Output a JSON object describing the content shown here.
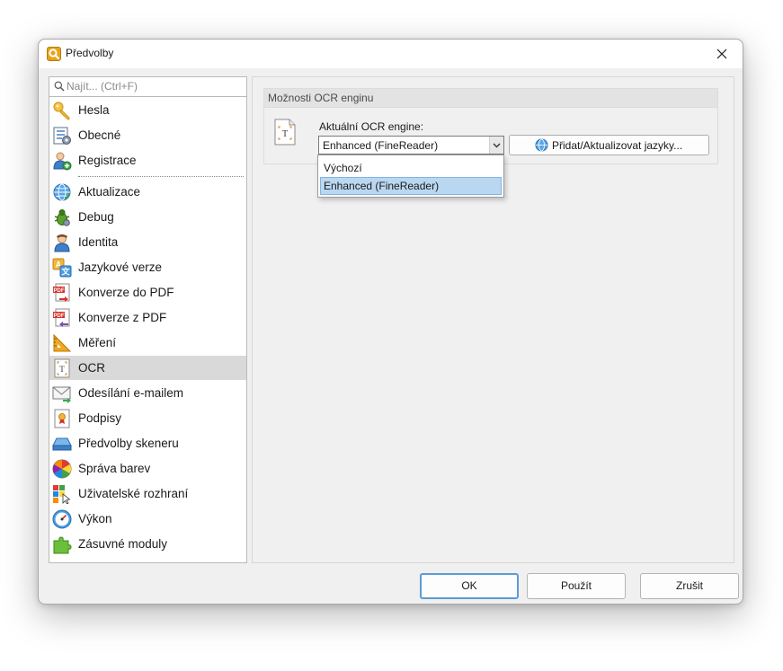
{
  "window": {
    "title": "Předvolby"
  },
  "search": {
    "placeholder": "Najít... (Ctrl+F)"
  },
  "sidebar": {
    "items": [
      {
        "label": "Hesla",
        "icon": "key-icon"
      },
      {
        "label": "Obecné",
        "icon": "general-settings-icon"
      },
      {
        "label": "Registrace",
        "icon": "user-add-icon"
      },
      {
        "label": "Aktualizace",
        "icon": "globe-update-icon"
      },
      {
        "label": "Debug",
        "icon": "bug-icon"
      },
      {
        "label": "Identita",
        "icon": "person-icon"
      },
      {
        "label": "Jazykové verze",
        "icon": "language-icon"
      },
      {
        "label": "Konverze do PDF",
        "icon": "convert-to-pdf-icon"
      },
      {
        "label": "Konverze z PDF",
        "icon": "convert-from-pdf-icon"
      },
      {
        "label": "Měření",
        "icon": "ruler-icon"
      },
      {
        "label": "OCR",
        "icon": "ocr-icon"
      },
      {
        "label": "Odesílání e-mailem",
        "icon": "email-icon"
      },
      {
        "label": "Podpisy",
        "icon": "signature-icon"
      },
      {
        "label": "Předvolby skeneru",
        "icon": "scanner-icon"
      },
      {
        "label": "Správa barev",
        "icon": "color-wheel-icon"
      },
      {
        "label": "Uživatelské rozhraní",
        "icon": "ui-cursor-icon"
      },
      {
        "label": "Výkon",
        "icon": "gauge-icon"
      },
      {
        "label": "Zásuvné moduly",
        "icon": "puzzle-icon"
      }
    ],
    "selected": "OCR"
  },
  "ocr": {
    "group_title": "Možnosti OCR enginu",
    "engine_label": "Aktuální OCR engine:",
    "engine_value": "Enhanced (FineReader)",
    "add_languages_button": "Přidat/Aktualizovat jazyky...",
    "dropdown_options": [
      "Výchozí",
      "Enhanced (FineReader)"
    ],
    "highlighted_option": "Enhanced (FineReader)"
  },
  "footer": {
    "ok": "OK",
    "apply": "Použít",
    "cancel": "Zrušit"
  },
  "colors": {
    "selection": "#d9d9d9",
    "dropdown_highlight": "#bad7f1",
    "default_button_border": "#5b9bd5"
  }
}
